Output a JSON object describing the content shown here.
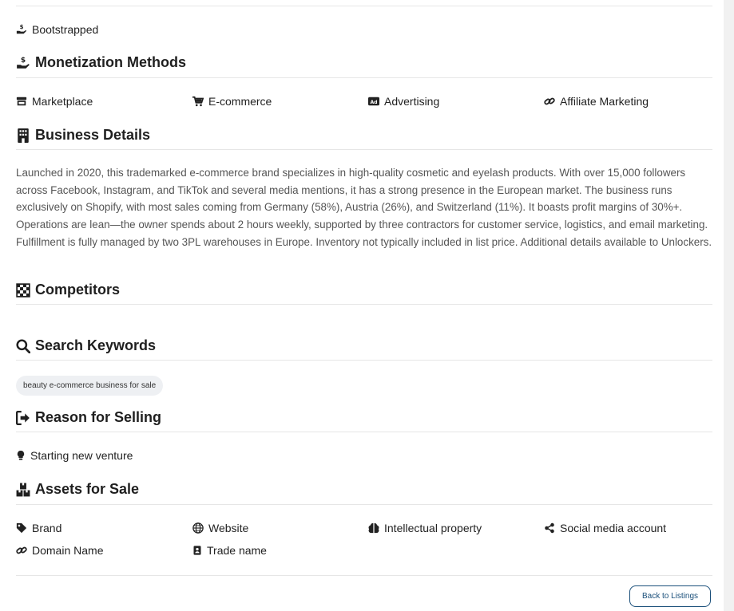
{
  "funding": {
    "label": "Bootstrapped",
    "icon": "hand-holding-dollar-icon"
  },
  "monetization": {
    "heading": "Monetization Methods",
    "items": [
      {
        "label": "Marketplace",
        "icon": "store-icon"
      },
      {
        "label": "E-commerce",
        "icon": "cart-icon"
      },
      {
        "label": "Advertising",
        "icon": "ad-icon"
      },
      {
        "label": "Affiliate Marketing",
        "icon": "link-icon"
      }
    ]
  },
  "business_details": {
    "heading": "Business Details",
    "description": "Launched in 2020, this trademarked e-commerce brand specializes in high-quality cosmetic and eyelash products. With over 15,000 followers across Facebook, Instagram, and TikTok and several media mentions, it has a strong presence in the European market. The business runs exclusively on Shopify, with most sales coming from Germany (58%), Austria (26%), and Switzerland (11%). It boasts profit margins of 30%+. Operations are lean—the owner spends about 2 hours weekly, supported by three contractors for customer service, logistics, and email marketing. Fulfillment is fully managed by two 3PL warehouses in Europe. Inventory not typically included in list price. Additional details available to Unlockers."
  },
  "competitors": {
    "heading": "Competitors"
  },
  "search_keywords": {
    "heading": "Search Keywords",
    "tags": [
      "beauty e-commerce business for sale"
    ]
  },
  "reason_for_selling": {
    "heading": "Reason for Selling",
    "value": "Starting new venture"
  },
  "assets": {
    "heading": "Assets for Sale",
    "items": [
      {
        "label": "Brand",
        "icon": "tag-icon"
      },
      {
        "label": "Website",
        "icon": "globe-icon"
      },
      {
        "label": "Intellectual property",
        "icon": "brain-icon"
      },
      {
        "label": "Social media account",
        "icon": "share-nodes-icon"
      },
      {
        "label": "Domain Name",
        "icon": "link-icon"
      },
      {
        "label": "Trade name",
        "icon": "id-badge-icon"
      }
    ]
  },
  "footer": {
    "back_label": "Back to Listings"
  },
  "colors": {
    "accent": "#1a4f7a",
    "text": "#1f1f1f",
    "muted": "#555555",
    "chip_bg": "#eef0f3"
  }
}
